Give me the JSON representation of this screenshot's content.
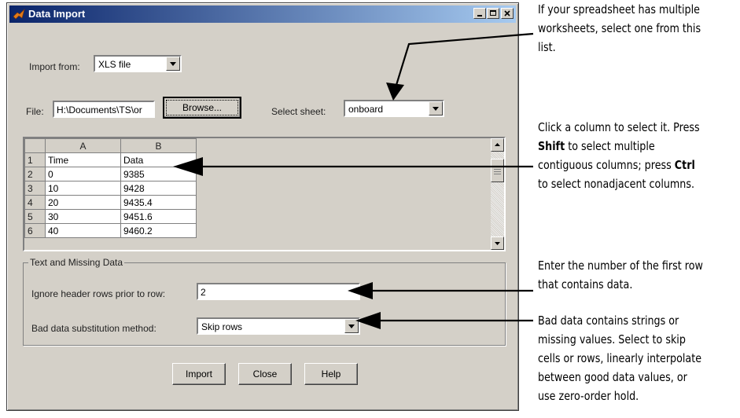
{
  "window": {
    "title": "Data Import",
    "icon": "matlab-icon"
  },
  "import_from": {
    "label": "Import from:",
    "value": "XLS file"
  },
  "file": {
    "label": "File:",
    "value": "H:\\Documents\\TS\\or",
    "browse_label": "Browse..."
  },
  "sheet": {
    "label": "Select sheet:",
    "value": "onboard"
  },
  "grid": {
    "columns": [
      "A",
      "B"
    ],
    "rows": [
      {
        "num": "1",
        "a": "Time",
        "b": "Data"
      },
      {
        "num": "2",
        "a": "0",
        "b": "9385"
      },
      {
        "num": "3",
        "a": "10",
        "b": "9428"
      },
      {
        "num": "4",
        "a": "20",
        "b": "9435.4"
      },
      {
        "num": "5",
        "a": "30",
        "b": "9451.6"
      },
      {
        "num": "6",
        "a": "40",
        "b": "9460.2"
      }
    ]
  },
  "text_missing": {
    "legend": "Text and Missing Data",
    "header_label": "Ignore header rows prior to row:",
    "header_value": "2",
    "bad_label": "Bad data substitution method:",
    "bad_value": "Skip rows"
  },
  "buttons": {
    "import": "Import",
    "close": "Close",
    "help": "Help"
  },
  "annotations": {
    "sheet": [
      "If your spreadsheet has multiple",
      "worksheets, select one from this",
      "list."
    ],
    "column": {
      "line1": "Click a column to select it. Press",
      "shift": "Shift",
      "line2_rest": " to select multiple",
      "line3a": "contiguous columns; press ",
      "ctrl": "Ctrl",
      "line4": "to select nonadjacent columns."
    },
    "row": [
      "Enter the number of the first row",
      "that contains data."
    ],
    "bad": [
      "Bad data contains strings or",
      "missing values. Select to skip",
      "cells or rows, linearly interpolate",
      "between good data values, or",
      "use zero-order hold."
    ]
  }
}
